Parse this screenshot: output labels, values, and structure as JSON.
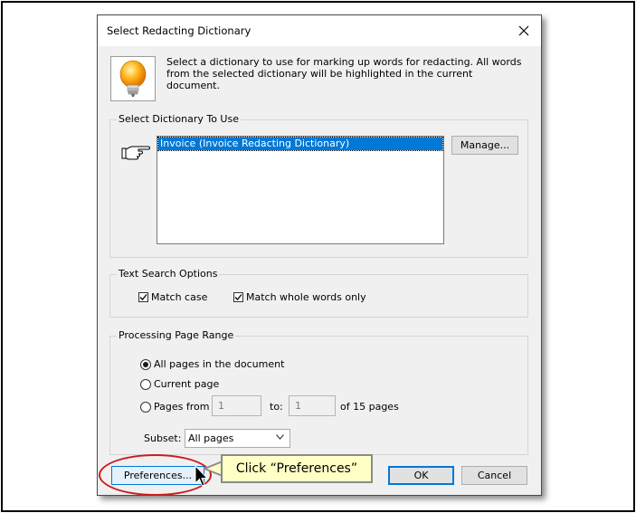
{
  "dialog": {
    "title": "Select Redacting Dictionary",
    "description": "Select a dictionary to use for marking up words for redacting. All words from the selected dictionary will be highlighted in the current document."
  },
  "dictionary_group": {
    "label": "Select Dictionary To Use",
    "items": [
      "Invoice (Invoice Redacting Dictionary)"
    ],
    "selected_index": 0,
    "manage_label": "Manage..."
  },
  "search_options": {
    "label": "Text Search Options",
    "match_case": {
      "label": "Match case",
      "checked": true
    },
    "match_whole_words": {
      "label": "Match whole words only",
      "checked": true
    }
  },
  "page_range": {
    "label": "Processing Page Range",
    "all_pages": {
      "label": "All pages in the document",
      "selected": true
    },
    "current_page": {
      "label": "Current page",
      "selected": false
    },
    "pages_from": {
      "label": "Pages from",
      "selected": false
    },
    "from_value": "1",
    "to_label": "to:",
    "to_value": "1",
    "of_pages_label": "of 15 pages",
    "subset_label": "Subset:",
    "subset_value": "All pages"
  },
  "buttons": {
    "preferences": "Preferences...",
    "ok": "OK",
    "cancel": "Cancel"
  },
  "callout": {
    "text": "Click “Preferences”"
  },
  "colors": {
    "selection": "#0078d7",
    "highlight_ring": "#cc1b1b",
    "callout_bg": "#ffffc6"
  }
}
